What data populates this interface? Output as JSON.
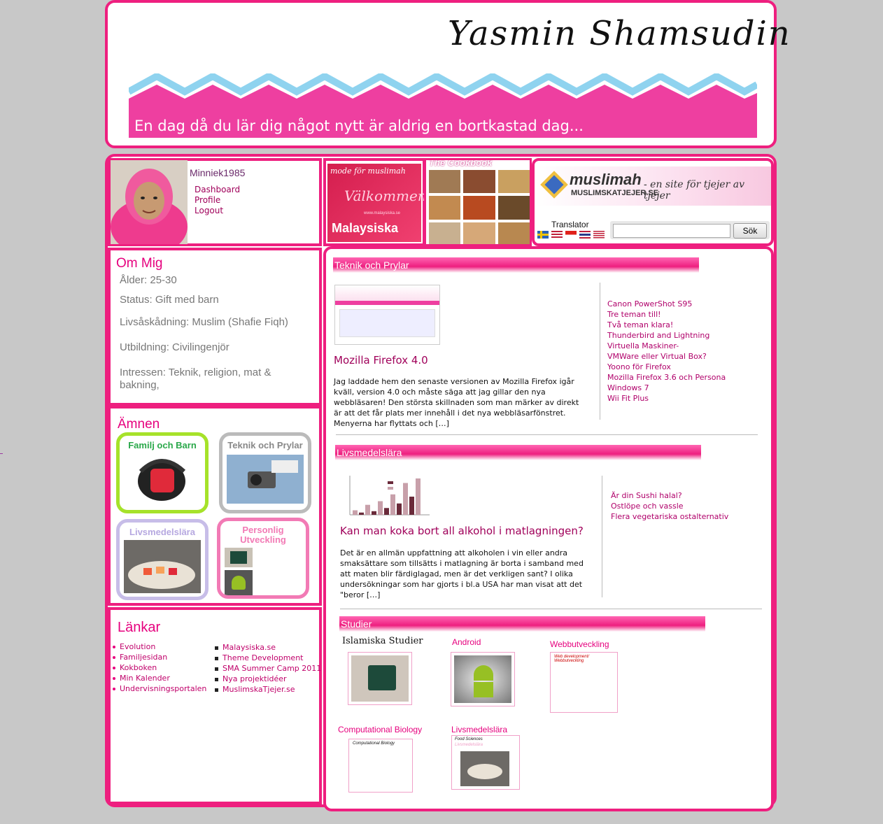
{
  "header": {
    "title": "Yasmin Shamsudin",
    "tagline": "En dag då du lär dig något nytt är aldrig en bortkastad dag..."
  },
  "user": {
    "name": "Minniek1985",
    "links": [
      "Dashboard",
      "Profile",
      "Logout"
    ]
  },
  "ommig": {
    "title": "Om Mig",
    "lines": [
      "Ålder: 25-30",
      "Status: Gift med barn",
      "Livsåskådning: Muslim (Shafie Fiqh)",
      "Utbildning: Civilingenjör",
      "Intressen: Teknik, religion, mat &",
      "bakning,"
    ]
  },
  "amnen": {
    "title": "Ämnen",
    "topics": [
      "Familj och Barn",
      "Teknik och Prylar",
      "Livsmedelslära",
      "Personlig",
      "Utveckling"
    ]
  },
  "lankar": {
    "title": "Länkar",
    "left": [
      "Evolution",
      "Familjesidan",
      "Kokboken",
      "Min Kalender",
      "Undervisningsportalen"
    ],
    "right": [
      "Malaysiska.se",
      "Theme Development",
      "SMA Summer Camp 2011",
      "Nya projektidéer",
      "MuslimskaTjejer.se"
    ]
  },
  "malay": {
    "top_text": "mode för muslimah",
    "welcome": "Välkommen",
    "url": "www.malaysiska.se",
    "brand": "Malaysiska"
  },
  "cookbook": {
    "title": "The Cookbook"
  },
  "muslimah": {
    "logo": "muslimah",
    "site": "MUSLIMSKATJEJER.SE",
    "slogan": "- en site för tjejer av tjejer",
    "translator": "Translator",
    "search_button": "Sök",
    "search_placeholder": ""
  },
  "sections": {
    "teknik": {
      "title": "Teknik och Prylar",
      "post_title": "Mozilla Firefox 4.0",
      "body": [
        "Jag laddade hem den senaste versionen av Mozilla Firefox igår",
        "kväll, version 4.0 och måste säga att jag gillar den nya",
        "webbläsaren! Den största skillnaden som man märker av direkt",
        "är att det får plats mer innehåll i det nya webbläsarfönstret.",
        "Menyerna har flyttats och […]"
      ],
      "links": [
        "Canon PowerShot S95",
        "Tre teman till!",
        "Två teman klara!",
        "Thunderbird and Lightning",
        "Virtuella Maskiner-",
        "VMWare eller Virtual Box?",
        "Yoono för Firefox",
        "Mozilla Firefox 3.6 och Persona",
        "Windows 7",
        "Wii Fit Plus"
      ]
    },
    "livsmedel": {
      "title": "Livsmedelslära",
      "post_title": "Kan man koka bort all alkohol i matlagningen?",
      "body": [
        "Det är en allmän uppfattning att alkoholen i vin eller andra",
        "smaksättare som tillsätts i matlagning är borta i samband med",
        "att maten blir färdiglagad, men är det verkligen sant? I olika",
        "undersökningar som har gjorts i bl.a USA har man visat att det",
        "\"beror […]"
      ],
      "links": [
        "Är din Sushi halal?",
        "Ostlöpe och vassle",
        "Flera vegetariska ostalternativ"
      ]
    },
    "studier": {
      "title": "Studier",
      "items": [
        "Islamiska Studier",
        "Android",
        "Webbutveckling",
        "Computational Biology",
        "Livsmedelslära"
      ],
      "thumb_webb": "Web development/ Webbutveckling",
      "thumb_comp": "Computational Biology",
      "thumb_food_a": "Food Sciences",
      "thumb_food_b": "Livsmedelslära"
    }
  },
  "colors": {
    "accent": "#ee1f7f",
    "link": "#a0005a"
  },
  "chart_small": {
    "values": [
      10,
      5,
      22,
      8,
      30,
      15,
      45,
      25,
      70,
      40,
      80
    ]
  }
}
